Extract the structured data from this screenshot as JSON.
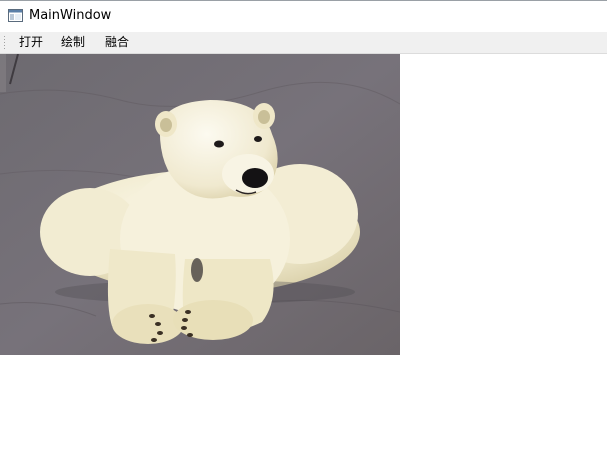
{
  "window": {
    "title": "MainWindow",
    "icon": "window-app-icon"
  },
  "toolbar": {
    "open_label": "打开",
    "draw_label": "绘制",
    "blend_label": "融合"
  },
  "image": {
    "subject": "polar-bear-photo",
    "colors": {
      "background_floor": "#6e6a6e",
      "fur": "#f1ecd2"
    }
  }
}
